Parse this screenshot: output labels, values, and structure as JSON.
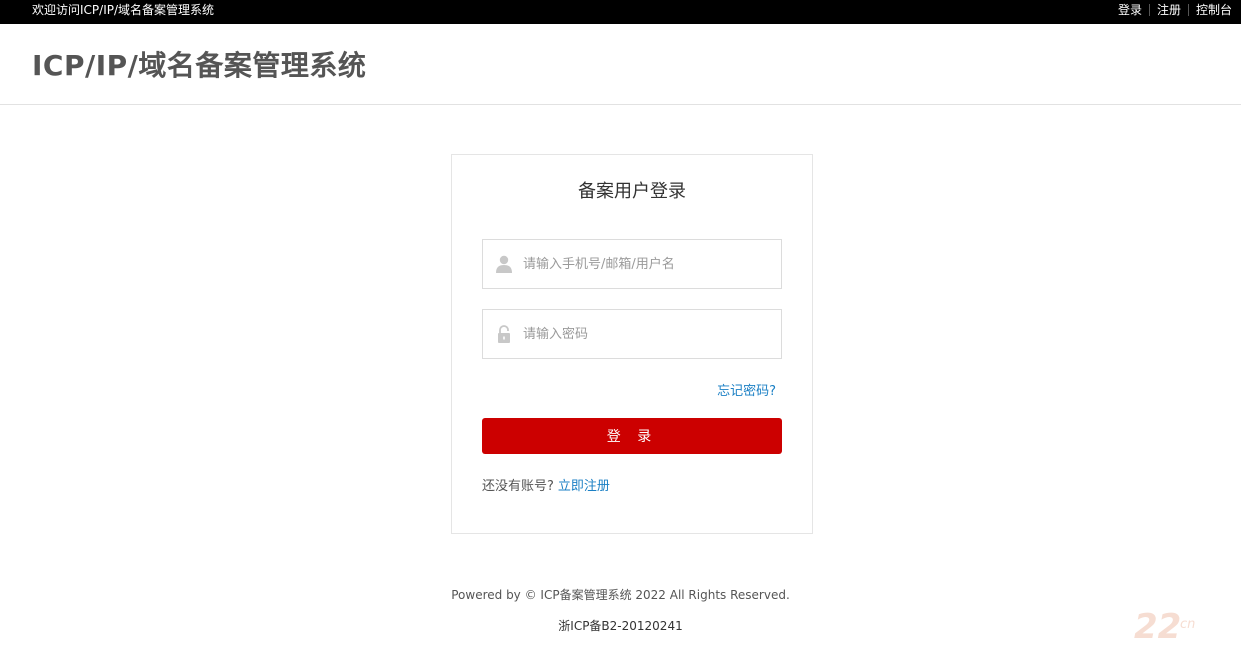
{
  "topbar": {
    "welcome": "欢迎访问ICP/IP/域名备案管理系统",
    "links": [
      "登录",
      "注册",
      "控制台"
    ]
  },
  "header": {
    "title": "ICP/IP/域名备案管理系统"
  },
  "login": {
    "title": "备案用户登录",
    "username_placeholder": "请输入手机号/邮箱/用户名",
    "password_placeholder": "请输入密码",
    "forgot": "忘记密码?",
    "button": "登 录",
    "no_account": "还没有账号?",
    "register_now": "立即注册",
    "icons": [
      "user-icon",
      "lock-icon"
    ]
  },
  "footer": {
    "powered": "Powered by © ICP备案管理系统 2022 All Rights Reserved.",
    "icp": "浙ICP备B2-20120241"
  },
  "watermark": {
    "text": "22",
    "suffix": "cn"
  },
  "colors": {
    "accent": "#cc0000",
    "link": "#1a7fc4",
    "topbar": "#000000"
  }
}
